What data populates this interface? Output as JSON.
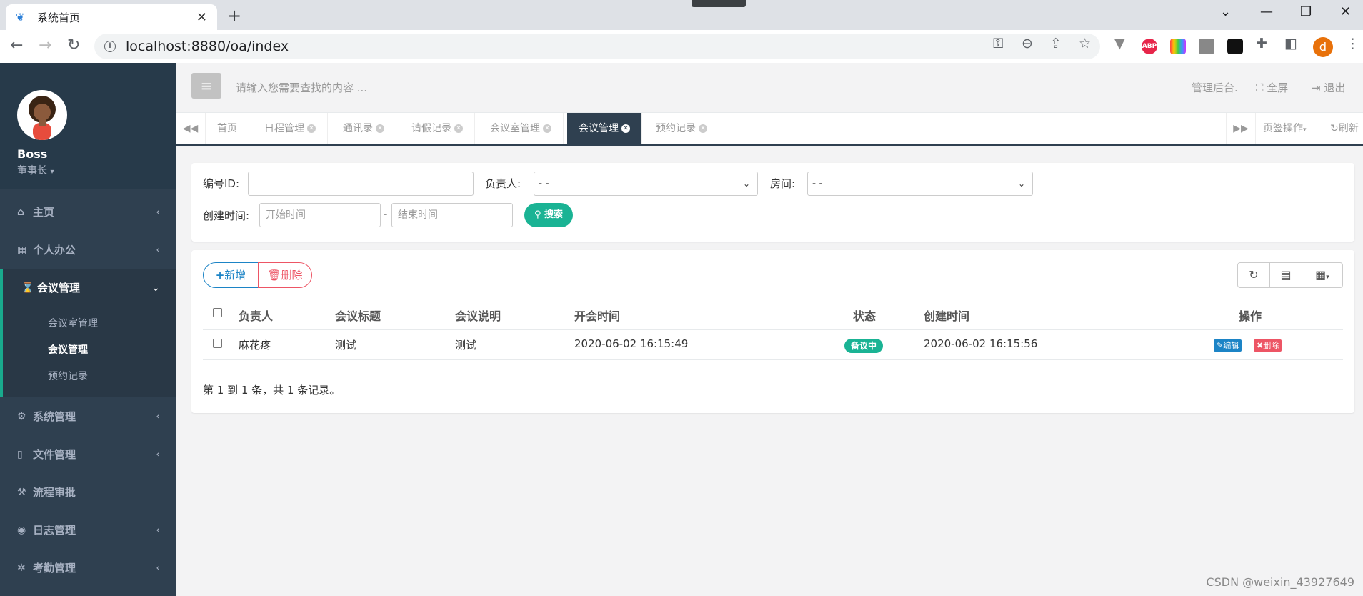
{
  "browser": {
    "tab_title": "系统首页",
    "url": "localhost:8880/oa/index",
    "profile_letter": "d",
    "ext_abp": "ABP"
  },
  "sidebar": {
    "user_name": "Boss",
    "user_role": "董事长",
    "items": [
      {
        "label": "主页",
        "icon": "home-icon"
      },
      {
        "label": "个人办公",
        "icon": "calendar-icon"
      },
      {
        "label": "会议管理",
        "icon": "hourglass-icon"
      },
      {
        "label": "系统管理",
        "icon": "gear-icon"
      },
      {
        "label": "文件管理",
        "icon": "file-icon"
      },
      {
        "label": "流程审批",
        "icon": "gavel-icon"
      },
      {
        "label": "日志管理",
        "icon": "eye-icon"
      },
      {
        "label": "考勤管理",
        "icon": "gears-icon"
      }
    ],
    "submenu": [
      "会议室管理",
      "会议管理",
      "预约记录"
    ]
  },
  "header": {
    "search_placeholder": "请输入您需要查找的内容 ...",
    "admin_link": "管理后台.",
    "fullscreen": "全屏",
    "logout": "退出"
  },
  "page_tabs": [
    "首页",
    "日程管理",
    "通讯录",
    "请假记录",
    "会议室管理",
    "会议管理",
    "预约记录"
  ],
  "page_tabs_right": {
    "ops": "页签操作",
    "refresh": "刷新"
  },
  "filters": {
    "id_label": "编号ID:",
    "owner_label": "负责人:",
    "owner_value": "- -",
    "room_label": "房间:",
    "room_value": "- -",
    "created_label": "创建时间:",
    "start_placeholder": "开始时间",
    "dash": "-",
    "end_placeholder": "结束时间",
    "search_button": "搜索"
  },
  "table": {
    "add_button": "新增",
    "delete_button": "删除",
    "headers": [
      "负责人",
      "会议标题",
      "会议说明",
      "开会时间",
      "状态",
      "创建时间",
      "操作"
    ],
    "rows": [
      {
        "owner": "麻花疼",
        "title": "测试",
        "desc": "测试",
        "start": "2020-06-02 16:15:49",
        "status": "备议中",
        "created": "2020-06-02 16:15:56",
        "edit": "编辑",
        "del": "删除"
      }
    ],
    "pager": "第 1 到 1 条，共 1 条记录。"
  },
  "watermark": "CSDN @weixin_43927649",
  "colors": {
    "sidebar": "#2f4050",
    "accent": "#1ab394",
    "primary": "#1c84c6",
    "danger": "#ed5565"
  }
}
